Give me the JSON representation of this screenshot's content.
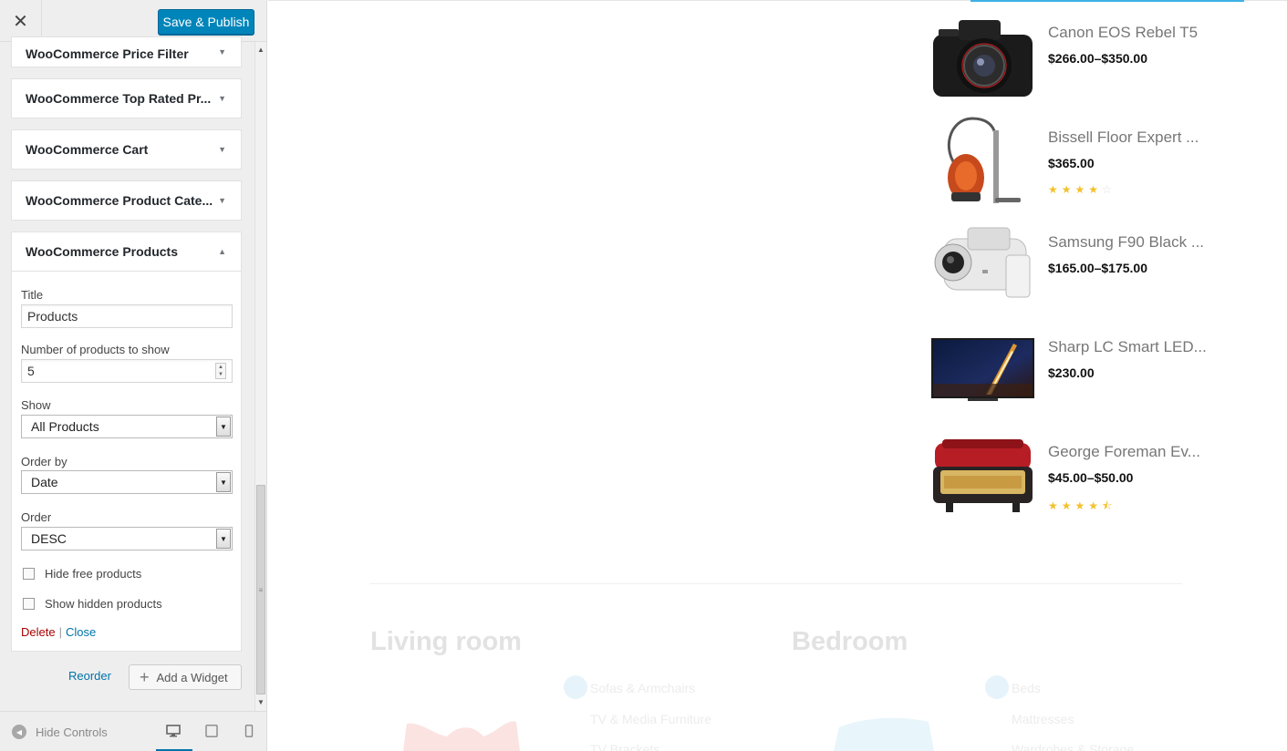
{
  "header": {
    "close_label": "✕",
    "save_label": "Save & Publish"
  },
  "widgets": [
    {
      "title": "WooCommerce Price Filter"
    },
    {
      "title": "WooCommerce Top Rated Pr..."
    },
    {
      "title": "WooCommerce Cart"
    },
    {
      "title": "WooCommerce Product Cate..."
    },
    {
      "title": "WooCommerce Products"
    }
  ],
  "products_form": {
    "title_label": "Title",
    "title_value": "Products",
    "count_label": "Number of products to show",
    "count_value": "5",
    "show_label": "Show",
    "show_value": "All Products",
    "orderby_label": "Order by",
    "orderby_value": "Date",
    "order_label": "Order",
    "order_value": "DESC",
    "hide_free_label": "Hide free products",
    "show_hidden_label": "Show hidden products",
    "delete_label": "Delete",
    "separator": "|",
    "close_label": "Close"
  },
  "panel_actions": {
    "reorder_label": "Reorder",
    "add_widget_label": "Add a Widget"
  },
  "footer": {
    "hide_controls_label": "Hide Controls"
  },
  "products": [
    {
      "name": "Canon EOS Rebel T5",
      "price": "$266.00–$350.00",
      "rating": 0
    },
    {
      "name": "Bissell Floor Expert ...",
      "price": "$365.00",
      "rating": 4
    },
    {
      "name": "Samsung F90 Black ...",
      "price": "$165.00–$175.00",
      "rating": 0
    },
    {
      "name": "Sharp LC Smart LED...",
      "price": "$230.00",
      "rating": 0
    },
    {
      "name": "George Foreman Ev...",
      "price": "$45.00–$50.00",
      "rating": 4.5
    }
  ],
  "categories": [
    {
      "title": "Living room",
      "links": [
        "Sofas & Armchairs",
        "TV & Media Furniture",
        "TV Brackets"
      ]
    },
    {
      "title": "Bedroom",
      "links": [
        "Beds",
        "Mattresses",
        "Wardrobes & Storage"
      ]
    }
  ],
  "colors": {
    "accent": "#0085ba",
    "link": "#0073aa",
    "delete": "#aa0000",
    "star": "#f3c12b"
  }
}
